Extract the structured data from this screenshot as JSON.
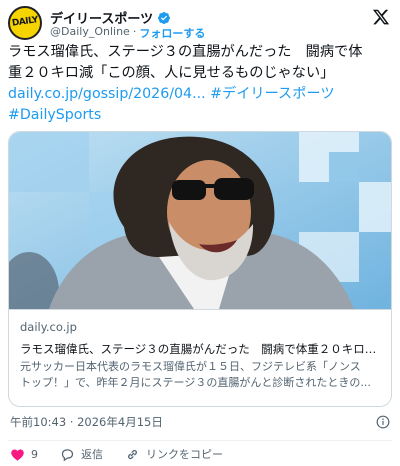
{
  "account": {
    "avatar_text": "DAILY",
    "display_name": "デイリースポーツ",
    "handle": "@Daily_Online",
    "separator": "·",
    "follow_label": "フォローする"
  },
  "tweet": {
    "line1": "ラモス瑠偉氏、ステージ３の直腸がんだった　闘病で体",
    "line2": "重２０キロ減「この顔、人に見せるものじゃない」",
    "link": "daily.co.jp/gossip/2026/04...",
    "hashtag1": "#デイリースポーツ",
    "hashtag2": "#DailySports"
  },
  "card": {
    "domain": "daily.co.jp",
    "title": "ラモス瑠偉氏、ステージ３の直腸がんだった　闘病で体重２０キロ減...",
    "desc_line1": "元サッカー日本代表のラモス瑠偉氏が１５日、フジテレビ系「ノンス",
    "desc_line2": "トップ！」で、昨年２月にステージ３の直腸がんと診断されたときの..."
  },
  "meta": {
    "timestamp": "午前10:43 · 2026年4月15日"
  },
  "actions": {
    "like_count": "9",
    "reply_label": "返信",
    "copy_link_label": "リンクをコピー"
  },
  "colors": {
    "accent": "#1d9bf0",
    "like": "#f91880",
    "text_secondary": "#536471",
    "border": "#cfd9de"
  },
  "icons": [
    "verified-badge-icon",
    "x-logo-icon",
    "info-icon",
    "heart-icon",
    "reply-icon",
    "link-icon"
  ]
}
